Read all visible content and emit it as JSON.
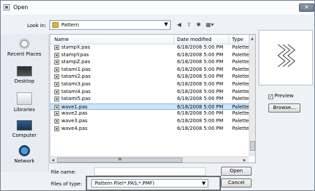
{
  "window": {
    "title": "Open",
    "close_glyph": "✕"
  },
  "look_in": {
    "label": "Look in:",
    "value": "Pattern"
  },
  "places": [
    {
      "label": "Recent Places",
      "icon": "recent-places-icon"
    },
    {
      "label": "Desktop",
      "icon": "desktop-icon"
    },
    {
      "label": "Libraries",
      "icon": "libraries-icon"
    },
    {
      "label": "Computer",
      "icon": "computer-icon"
    },
    {
      "label": "Network",
      "icon": "network-icon"
    }
  ],
  "columns": {
    "name": "Name",
    "date": "Date modified",
    "type": "Type"
  },
  "files": [
    {
      "name": "stampX.pas",
      "date": "6/18/2008 5:00 PM",
      "type": "Palette"
    },
    {
      "name": "stampY.pas",
      "date": "6/18/2008 5:00 PM",
      "type": "Palette"
    },
    {
      "name": "stampZ.pas",
      "date": "6/18/2008 5:00 PM",
      "type": "Palette"
    },
    {
      "name": "tatami1.pas",
      "date": "6/18/2008 5:00 PM",
      "type": "Palette"
    },
    {
      "name": "tatami2.pas",
      "date": "6/18/2008 5:00 PM",
      "type": "Palette"
    },
    {
      "name": "tatami3.pas",
      "date": "6/18/2008 5:00 PM",
      "type": "Palette"
    },
    {
      "name": "tatami4.pas",
      "date": "6/18/2008 5:00 PM",
      "type": "Palette"
    },
    {
      "name": "tatami5.pas",
      "date": "6/18/2008 5:00 PM",
      "type": "Palette"
    },
    {
      "name": "wave1.pas",
      "date": "6/18/2008 5:00 PM",
      "type": "Palette"
    },
    {
      "name": "wave2.pas",
      "date": "6/18/2008 5:00 PM",
      "type": "Palette"
    },
    {
      "name": "wave3.pas",
      "date": "6/18/2008 5:00 PM",
      "type": "Palette"
    },
    {
      "name": "wave4.pas",
      "date": "6/18/2008 5:00 PM",
      "type": "Palette"
    }
  ],
  "selected_file": "wave1.pas",
  "scrollbar": {
    "thumb_glyph": "III"
  },
  "preview": {
    "label": "Preview",
    "checked": true,
    "check_glyph": "✓"
  },
  "buttons": {
    "browse": "Browse...",
    "open": "Open",
    "cancel": "Cancel"
  },
  "file_name": {
    "label": "File name:",
    "value": ""
  },
  "file_type": {
    "label": "Files of type:",
    "value": "Pattern File(*.PAS;*.PMF)"
  },
  "colors": {
    "selection": "#cde6f7",
    "selection_border": "#7eb4ea",
    "preview_stroke": "#333333"
  }
}
